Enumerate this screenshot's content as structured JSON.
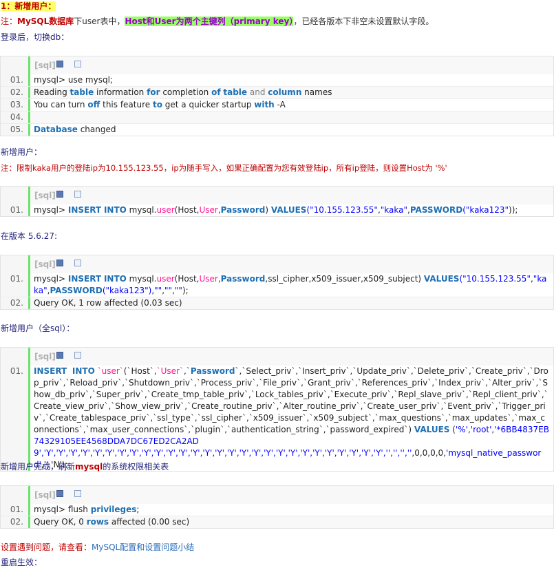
{
  "heading": "1：新增用户：",
  "note1": {
    "prefix": "注：",
    "db": "MySQL数据库",
    "mid": "下user表中，",
    "highlight": "Host和User为两个主键列（primary key）",
    "suffix": "，已经各版本下非空未设置默认字段。"
  },
  "login_note": "登录后，切换db：",
  "code_tag": "[sql]",
  "block1": {
    "nums": [
      "01.",
      "02.",
      "03.",
      "04.",
      "05."
    ],
    "line1": "mysql> use mysql;",
    "line2": [
      "Reading ",
      "table",
      " information ",
      "for",
      " completion ",
      "of",
      " ",
      "table",
      " ",
      "and",
      " ",
      "column",
      " names"
    ],
    "line3": [
      "You can turn ",
      "off",
      " this feature ",
      "to",
      " get a quicker startup ",
      "with",
      " -A"
    ],
    "line4": "",
    "line5": [
      "Database",
      " changed"
    ]
  },
  "add_user_label": "新增用户：",
  "note2": "注：限制kaka用户的登陆ip为10.155.123.55，ip为随手写入，如果正确配置为您有效登陆ip，所有ip登陆，则设置Host为 '%'",
  "block2": {
    "nums": [
      "01."
    ],
    "parts": [
      "mysql> ",
      "INSERT",
      " ",
      "INTO",
      " mysql.",
      "user",
      "(Host,",
      "User",
      ",",
      "Password",
      ") ",
      "VALUES",
      "(\"10.155.123.55\"",
      ",",
      "\"kaka\"",
      ",",
      "PASSWORD",
      "(\"kaka123\"",
      "));"
    ]
  },
  "version_note": "在版本 5.6.27:",
  "block3": {
    "nums": [
      "01.",
      "02."
    ],
    "parts": [
      "mysql> ",
      "INSERT",
      " ",
      "INTO",
      " mysql.",
      "user",
      "(Host,",
      "User",
      ",",
      "Password",
      ",ssl_cipher,x509_issuer,x509_subject) ",
      "VALUES",
      "(\"10.155.123.55\"",
      ",",
      "\"kaka\"",
      ",",
      "PASSWORD",
      "(\"kaka123\")",
      ",",
      "\"\"",
      ",",
      "\"\"",
      ",",
      "\"\"",
      ");"
    ],
    "line2": [
      "Query OK, 1 row affected (0.03 sec)"
    ]
  },
  "full_sql_label": "新增用户（全sql）：",
  "block4": {
    "nums": [
      "01."
    ],
    "kw_insert": "INSERT",
    "kw_into": "INTO",
    "table": "`user`",
    "host_open": "(`Host`,",
    "user_col": "`User`",
    "comma": ",",
    "pwd_col": "`Password`",
    "columns_rest": ",`Select_priv`,`Insert_priv`,`Update_priv`,`Delete_priv`,`Create_priv`,`Drop_priv`,`Reload_priv`,`Shutdown_priv`,`Process_priv`,`File_priv`,`Grant_priv`,`References_priv`,`Index_priv`,`Alter_priv`,`Show_db_priv`,`Super_priv`,`Create_tmp_table_priv`,`Lock_tables_priv`,`Execute_priv`,`Repl_slave_priv`,`Repl_client_priv`,`Create_view_priv`,`Show_view_priv`,`Create_routine_priv`,`Alter_routine_priv`,`Create_user_priv`,`Event_priv`,`Trigger_priv`,`Create_tablespace_priv`,`ssl_type`,`ssl_cipher`,`x509_issuer`,`x509_subject`,`max_questions`,`max_updates`,`max_connections`,`max_user_connections`,`plugin`,`authentication_string`,`password_expired`) ",
    "kw_values": "VALUES",
    "vals_open": " (",
    "v_pct": "'%'",
    "v_root": "'root'",
    "v_hash": "'*6BB4837EB74329105EE4568DDA7DC67ED2CA2AD9'",
    "v_ys": ",'Y','Y','Y','Y','Y','Y','Y','Y','Y','Y','Y','Y','Y','Y','Y','Y','Y','Y','Y','Y','Y','Y','Y','Y','Y','Y','Y','Y',",
    "v_empty": "'','','',''",
    "v_nums": ",0,0,0,0,",
    "v_plugin": "'mysql_native_password'",
    "v_tail": ",'','N');"
  },
  "refresh_note": {
    "prefix": "新增用户完成，刷新",
    "mysql": "mysql",
    "suffix": "的系统权限相关表"
  },
  "block5": {
    "nums": [
      "01.",
      "02."
    ],
    "line1": [
      "mysql> flush ",
      "privileges",
      ";"
    ],
    "line2": [
      "Query OK, 0 ",
      "rows",
      " affected (0.00 sec)"
    ]
  },
  "problem_note": {
    "prefix": "设置遇到问题，请查看：",
    "link": "MySQL配置和设置问题小结"
  },
  "restart_note": "重启生效："
}
